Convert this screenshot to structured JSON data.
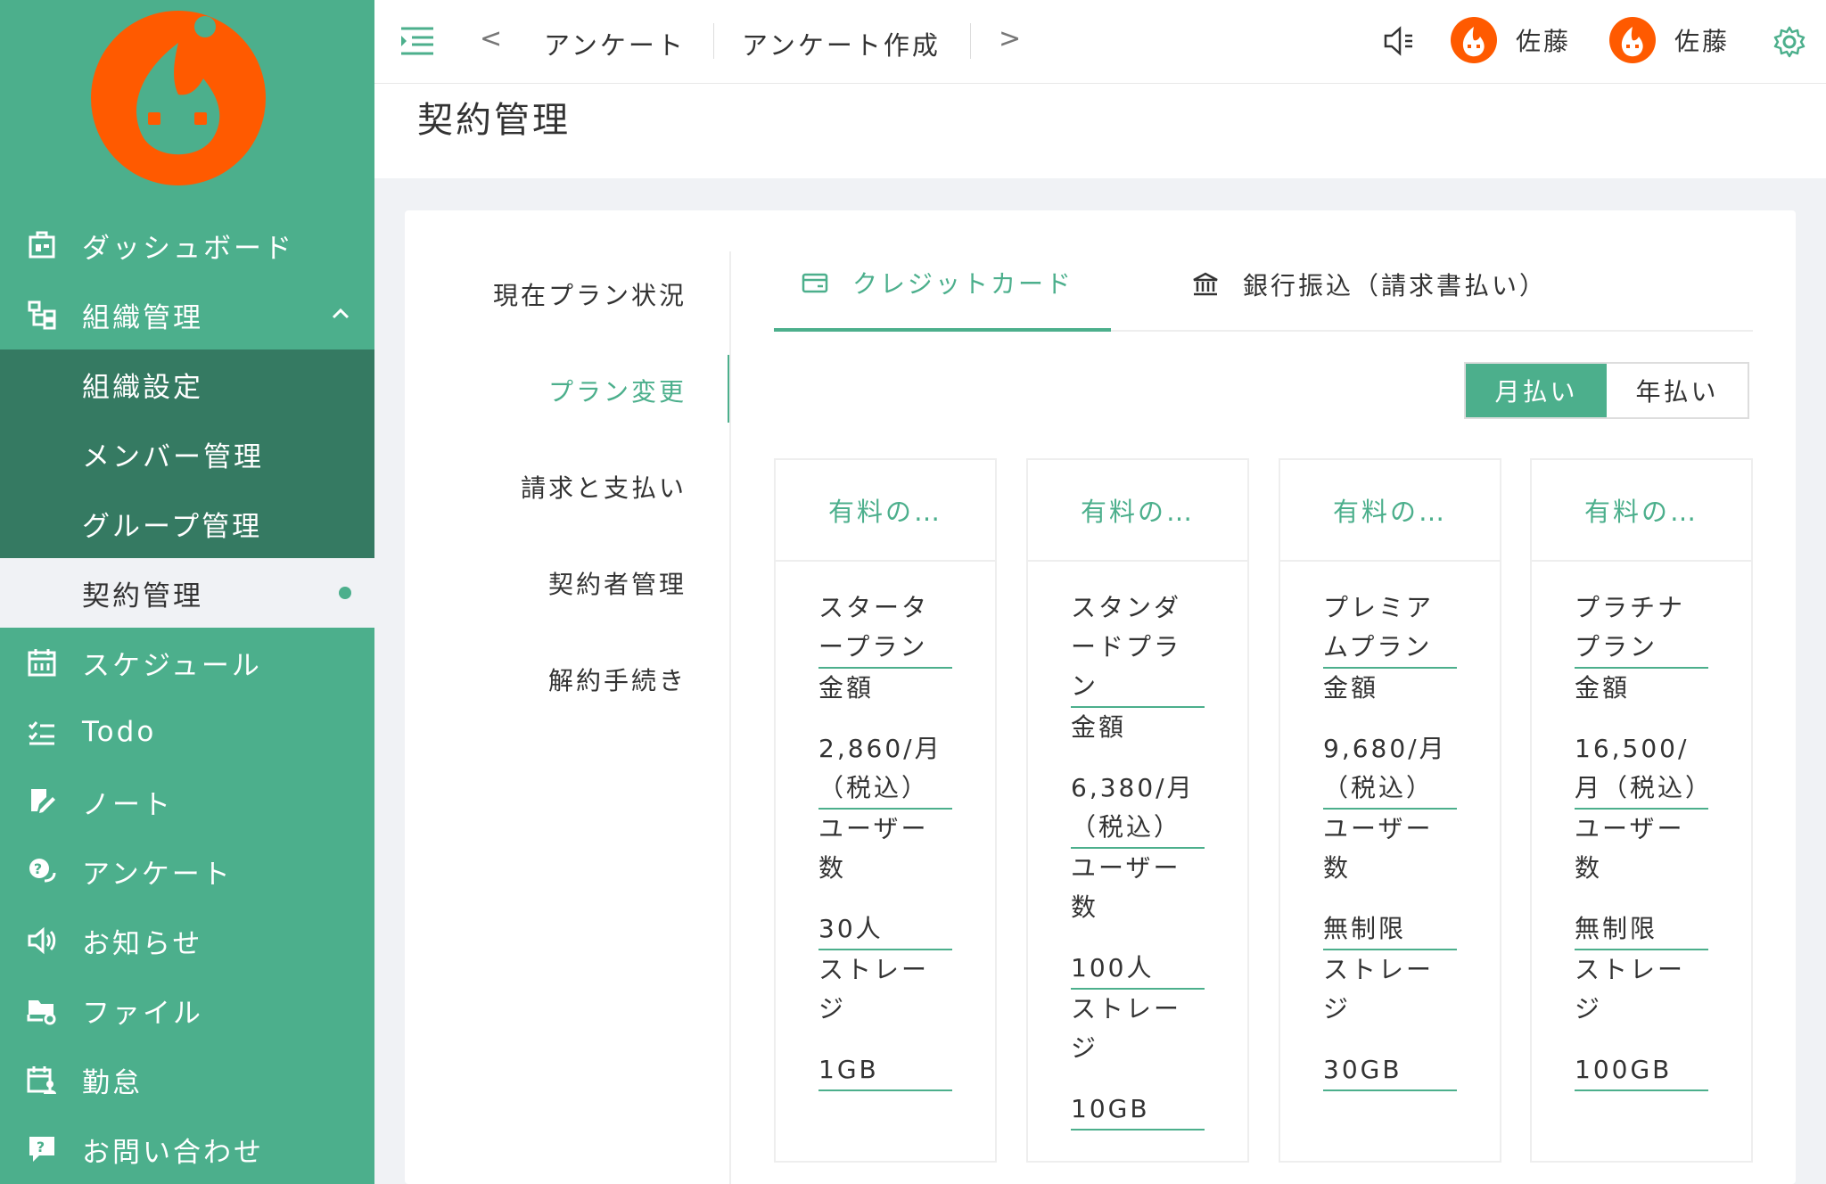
{
  "topbar": {
    "tabs": [
      "アンケート",
      "アンケート作成"
    ],
    "prev_glyph": "<",
    "next_glyph": ">",
    "users": [
      {
        "name": "佐藤"
      },
      {
        "name": "佐藤"
      }
    ]
  },
  "sidebar": {
    "items": [
      {
        "label": "ダッシュボード",
        "icon": "dashboard-icon"
      },
      {
        "label": "組織管理",
        "icon": "org-chart-icon",
        "expanded": true
      },
      {
        "label": "組織設定"
      },
      {
        "label": "メンバー管理"
      },
      {
        "label": "グループ管理"
      },
      {
        "label": "契約管理",
        "active": true
      },
      {
        "label": "スケジュール",
        "icon": "calendar-icon"
      },
      {
        "label": "Todo",
        "icon": "checklist-icon"
      },
      {
        "label": "ノート",
        "icon": "note-edit-icon"
      },
      {
        "label": "アンケート",
        "icon": "survey-icon"
      },
      {
        "label": "お知らせ",
        "icon": "speaker-icon"
      },
      {
        "label": "ファイル",
        "icon": "folder-gear-icon"
      },
      {
        "label": "勤怠",
        "icon": "attendance-icon"
      },
      {
        "label": "お問い合わせ",
        "icon": "inquiry-icon"
      }
    ]
  },
  "page": {
    "title": "契約管理"
  },
  "subnav": {
    "items": [
      "現在プラン状況",
      "プラン変更",
      "請求と支払い",
      "契約者管理",
      "解約手続き"
    ],
    "active_index": 1
  },
  "payment_tabs": {
    "credit": "クレジットカード",
    "bank": "銀行振込（請求書払い）"
  },
  "billing": {
    "monthly": "月払い",
    "yearly": "年払い"
  },
  "plans": [
    {
      "header": "有料の…",
      "name": "スタータープラン",
      "price_label": "金額",
      "price": "2,860/月（税込）",
      "users_label": "ユーザー数",
      "users": "30人",
      "storage_label": "ストレージ",
      "storage": "1GB"
    },
    {
      "header": "有料の…",
      "name": "スタンダードプラン",
      "price_label": "金額",
      "price": "6,380/月（税込）",
      "users_label": "ユーザー数",
      "users": "100人",
      "storage_label": "ストレージ",
      "storage": "10GB"
    },
    {
      "header": "有料の…",
      "name": "プレミアムプラン",
      "price_label": "金額",
      "price": "9,680/月（税込）",
      "users_label": "ユーザー数",
      "users": "無制限",
      "storage_label": "ストレージ",
      "storage": "30GB"
    },
    {
      "header": "有料の…",
      "name": "プラチナプラン",
      "price_label": "金額",
      "price": "16,500/月（税込）",
      "users_label": "ユーザー数",
      "users": "無制限",
      "storage_label": "ストレージ",
      "storage": "100GB"
    }
  ],
  "colors": {
    "accent": "#4caf8c",
    "sidebar_dark": "#357a62",
    "logo": "#ff5a00"
  }
}
